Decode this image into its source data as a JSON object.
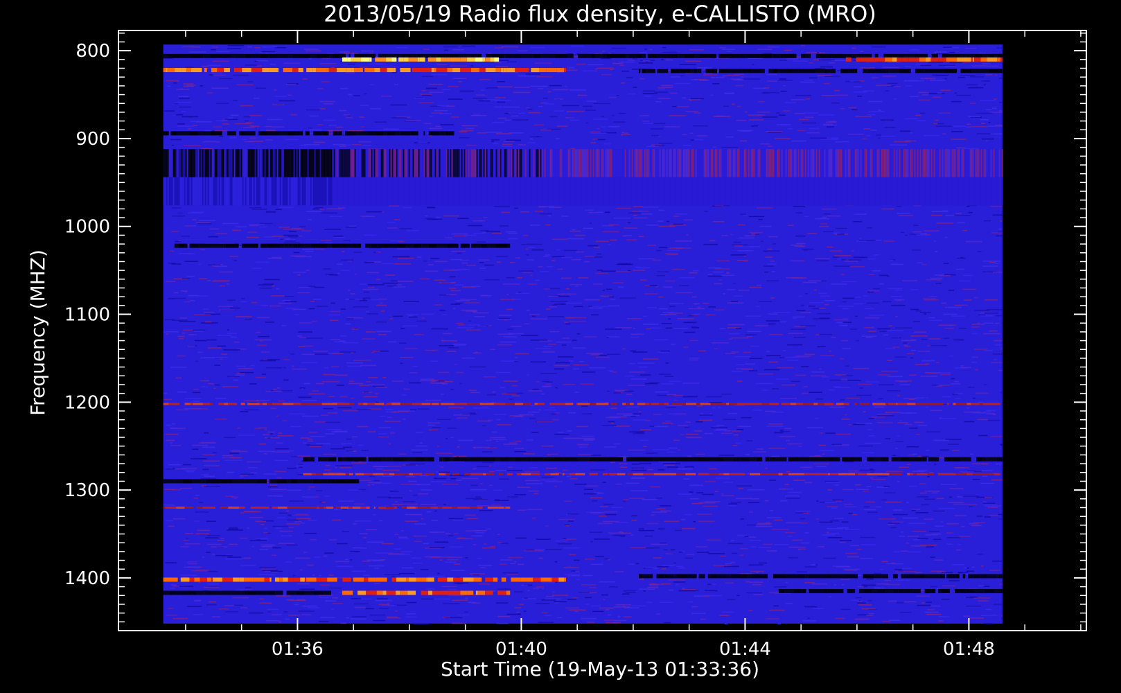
{
  "chart_data": {
    "type": "heatmap",
    "title": "2013/05/19  Radio flux density, e-CALLISTO (MRO)",
    "xlabel": "Start Time (19-May-13 01:33:36)",
    "ylabel": "Frequency (MHZ)",
    "x_start_label": "01:33:36",
    "xlim_minutes_from_0133_36": [
      -0.8,
      16.5
    ],
    "data_extent_minutes_from_0133_36": [
      0.0,
      15.0
    ],
    "ylim_mhz": [
      777,
      1460
    ],
    "ylim_data_mhz": [
      793,
      1452
    ],
    "y_inverted": true,
    "x_ticks": [
      {
        "label": "01:36",
        "minutes": 2.4
      },
      {
        "label": "01:40",
        "minutes": 6.4
      },
      {
        "label": "01:44",
        "minutes": 10.4
      },
      {
        "label": "01:48",
        "minutes": 14.4
      }
    ],
    "y_ticks": [
      {
        "label": "800",
        "mhz": 800
      },
      {
        "label": "900",
        "mhz": 900
      },
      {
        "label": "1000",
        "mhz": 1000
      },
      {
        "label": "1100",
        "mhz": 1100
      },
      {
        "label": "1200",
        "mhz": 1200
      },
      {
        "label": "1300",
        "mhz": 1300
      },
      {
        "label": "1400",
        "mhz": 1400
      }
    ],
    "colors": {
      "background": "#000000",
      "heatmap_base": "#2a1fd8",
      "low": "#000010",
      "mid": "#c0201a",
      "high": "#ff6a00",
      "peak": "#ffff80"
    },
    "grid": false,
    "legend": "none",
    "bands": [
      {
        "mhz": 806,
        "from": 0.0,
        "to": 15.0,
        "level": "low"
      },
      {
        "mhz": 810,
        "from": 3.2,
        "to": 6.0,
        "level": "peak"
      },
      {
        "mhz": 810,
        "from": 12.2,
        "to": 15.0,
        "level": "high"
      },
      {
        "mhz": 822,
        "from": 0.0,
        "to": 7.2,
        "level": "high"
      },
      {
        "mhz": 823,
        "from": 8.5,
        "to": 15.0,
        "level": "low"
      },
      {
        "mhz": 894,
        "from": 0.0,
        "to": 5.2,
        "level": "low"
      },
      {
        "mhz": 1022,
        "from": 0.2,
        "to": 6.2,
        "level": "low"
      },
      {
        "mhz": 1202,
        "from": 0.0,
        "to": 15.0,
        "level": "mid"
      },
      {
        "mhz": 1265,
        "from": 2.5,
        "to": 15.0,
        "level": "low"
      },
      {
        "mhz": 1282,
        "from": 2.5,
        "to": 15.0,
        "level": "mid"
      },
      {
        "mhz": 1290,
        "from": 0.0,
        "to": 3.5,
        "level": "low"
      },
      {
        "mhz": 1320,
        "from": 0.0,
        "to": 6.2,
        "level": "mid"
      },
      {
        "mhz": 1398,
        "from": 8.5,
        "to": 15.0,
        "level": "low"
      },
      {
        "mhz": 1402,
        "from": 0.0,
        "to": 7.2,
        "level": "high"
      },
      {
        "mhz": 1417,
        "from": 0.0,
        "to": 3.0,
        "level": "low"
      },
      {
        "mhz": 1417,
        "from": 3.2,
        "to": 6.2,
        "level": "high"
      },
      {
        "mhz": 1415,
        "from": 11.0,
        "to": 15.0,
        "level": "low"
      }
    ],
    "vertical_striping": {
      "from_mhz": 912,
      "to_mhz": 976
    }
  }
}
